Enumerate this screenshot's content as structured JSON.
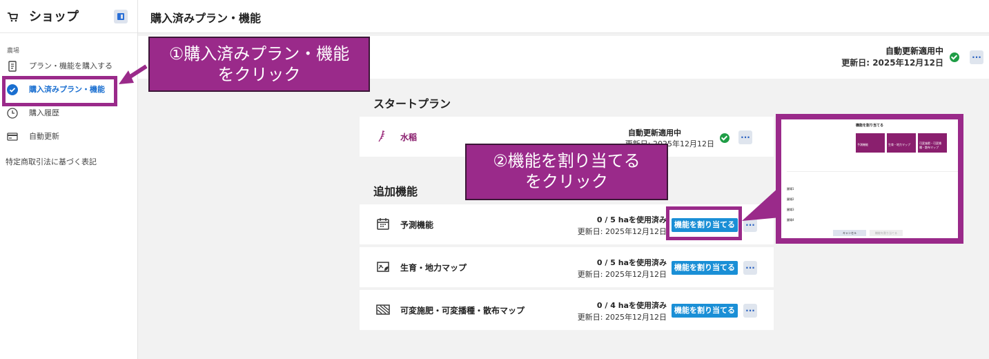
{
  "sidebar": {
    "title": "ショップ",
    "section": "農場",
    "items": [
      "プラン・機能を購入する",
      "購入済みプラン・機能",
      "購入履歴",
      "自動更新"
    ],
    "footer_link": "特定商取引法に基づく表記"
  },
  "header": {
    "title": "購入済みプラン・機能"
  },
  "status": {
    "label": "自動更新適用中",
    "updated": "更新日: 2025年12月12日"
  },
  "start_plan": {
    "heading": "スタートプラン",
    "name": "水稲",
    "label": "自動更新適用中",
    "updated": "更新日: 2025年12月12日"
  },
  "addons": {
    "heading": "追加機能",
    "items": [
      {
        "name": "予測機能",
        "usage": "0 / 5 haを使用済み",
        "updated": "更新日: 2025年12月12日",
        "button": "機能を割り当てる"
      },
      {
        "name": "生育・地力マップ",
        "usage": "0 / 5 haを使用済み",
        "updated": "更新日: 2025年12月12日",
        "button": "機能を割り当てる"
      },
      {
        "name": "可変施肥・可変播種・散布マップ",
        "usage": "0 / 4 haを使用済み",
        "updated": "更新日: 2025年12月12日",
        "button": "機能を割り当てる"
      }
    ]
  },
  "annotations": {
    "step1_line1": "①購入済みプラン・機能",
    "step1_line2": "をクリック",
    "step2_line1": "②機能を割り当てる",
    "step2_line2": "をクリック"
  },
  "dialog_preview": {
    "title": "機能を割り当てる",
    "cancel": "キャンセル",
    "confirm": "機能を割り当てる",
    "columns": [
      "予測機能",
      "生育・地力マップ",
      "可変施肥・可変播種・散布マップ"
    ],
    "rows": [
      "圃場1",
      "圃場2",
      "圃場3",
      "圃場4"
    ]
  },
  "colors": {
    "accent": "#1a8fd6",
    "annotation": "#9a2a8a",
    "success": "#1f9d46"
  }
}
